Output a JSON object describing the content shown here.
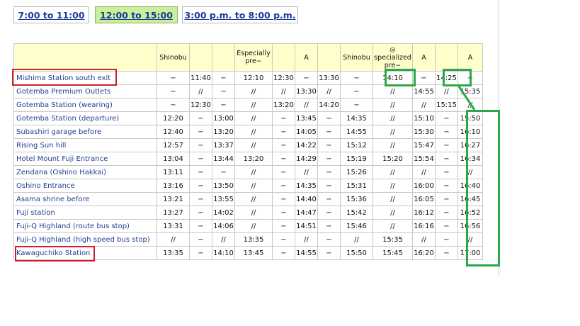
{
  "tabs": [
    {
      "label": "7:00 to 11:00",
      "active": false
    },
    {
      "label": "12:00 to 15:00",
      "active": true
    },
    {
      "label": "3:00 p.m. to 8:00 p.m.",
      "active": false
    }
  ],
  "columns": [
    "Shinobu",
    "",
    "",
    "Especially pre−",
    "",
    "A",
    "",
    "Shinobu",
    "◎ specialized pre−",
    "A",
    "",
    "A"
  ],
  "rows": [
    {
      "stop": "Mishima Station south exit",
      "times": [
        "−",
        "11:40",
        "−",
        "12:10",
        "12:30",
        "−",
        "13:30",
        "−",
        "14:10",
        "−",
        "14:25",
        "−"
      ]
    },
    {
      "stop": "Gotemba Premium Outlets",
      "times": [
        "−",
        "//",
        "−",
        "//",
        "//",
        "13:30",
        "//",
        "−",
        "//",
        "14:55",
        "//",
        "15:35"
      ]
    },
    {
      "stop": "Gotemba Station (wearing)",
      "times": [
        "−",
        "12:30",
        "−",
        "//",
        "13:20",
        "//",
        "14:20",
        "−",
        "//",
        "//",
        "15:15",
        "//"
      ]
    },
    {
      "stop": "Gotemba Station (departure)",
      "times": [
        "12:20",
        "−",
        "13:00",
        "//",
        "−",
        "13:45",
        "−",
        "14:35",
        "//",
        "15:10",
        "−",
        "15:50"
      ]
    },
    {
      "stop": "Subashiri garage before",
      "times": [
        "12:40",
        "−",
        "13:20",
        "//",
        "−",
        "14:05",
        "−",
        "14:55",
        "//",
        "15:30",
        "−",
        "16:10"
      ]
    },
    {
      "stop": "Rising Sun hill",
      "times": [
        "12:57",
        "−",
        "13:37",
        "//",
        "−",
        "14:22",
        "−",
        "15:12",
        "//",
        "15:47",
        "−",
        "16:27"
      ]
    },
    {
      "stop": "Hotel Mount Fuji Entrance",
      "times": [
        "13:04",
        "−",
        "13:44",
        "13:20",
        "−",
        "14:29",
        "−",
        "15:19",
        "15:20",
        "15:54",
        "−",
        "16:34"
      ]
    },
    {
      "stop": "Zendana (Oshino Hakkai)",
      "times": [
        "13:11",
        "−",
        "−",
        "//",
        "−",
        "//",
        "−",
        "15:26",
        "//",
        "//",
        "−",
        "//"
      ]
    },
    {
      "stop": "Oshino Entrance",
      "times": [
        "13:16",
        "−",
        "13:50",
        "//",
        "−",
        "14:35",
        "−",
        "15:31",
        "//",
        "16:00",
        "−",
        "16:40"
      ]
    },
    {
      "stop": "Asama shrine before",
      "times": [
        "13:21",
        "−",
        "13:55",
        "//",
        "−",
        "14:40",
        "−",
        "15:36",
        "//",
        "16:05",
        "−",
        "16:45"
      ]
    },
    {
      "stop": "Fuji station",
      "times": [
        "13:27",
        "−",
        "14:02",
        "//",
        "−",
        "14:47",
        "−",
        "15:42",
        "//",
        "16:12",
        "−",
        "16:52"
      ]
    },
    {
      "stop": "Fuji-Q Highland (route bus stop)",
      "times": [
        "13:31",
        "−",
        "14:06",
        "//",
        "−",
        "14:51",
        "−",
        "15:46",
        "//",
        "16:16",
        "−",
        "16:56"
      ]
    },
    {
      "stop": "Fuji-Q Highland (high speed bus stop)",
      "times": [
        "//",
        "−",
        "//",
        "13:35",
        "−",
        "//",
        "−",
        "//",
        "15:35",
        "//",
        "−",
        "//"
      ]
    },
    {
      "stop": "Kawaguchiko Station",
      "times": [
        "13:35",
        "−",
        "14:10",
        "13:45",
        "−",
        "14:55",
        "−",
        "15:50",
        "15:45",
        "16:20",
        "−",
        "17:00"
      ]
    }
  ],
  "colors": {
    "active_tab": "#c9f19a",
    "header_bg": "#ffffcc",
    "highlight_red": "#d01e2e",
    "highlight_green": "#2aa84a",
    "link": "#1f3f8f"
  }
}
